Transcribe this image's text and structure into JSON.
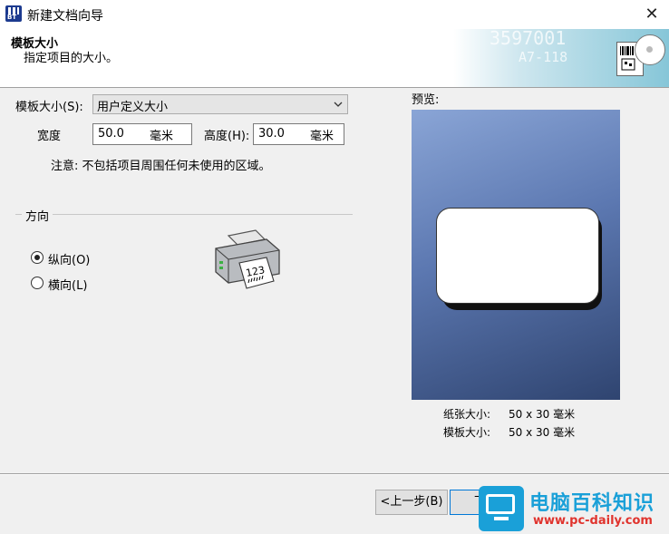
{
  "window": {
    "title": "新建文档向导",
    "close": "✕"
  },
  "header": {
    "title": "模板大小",
    "subtitle": "指定项目的大小。",
    "banner_numbers": [
      "3597001",
      "A7-118"
    ]
  },
  "form": {
    "size_label": "模板大小(S):",
    "size_value": "用户定义大小",
    "width_label": "宽度",
    "width_value": "50.0",
    "width_unit": "毫米",
    "height_label": "高度(H):",
    "height_value": "30.0",
    "height_unit": "毫米",
    "note": "注意: 不包括项目周围任何未使用的区域。"
  },
  "orientation": {
    "legend": "方向",
    "portrait": "纵向(O)",
    "landscape": "横向(L)",
    "selected": "portrait"
  },
  "preview": {
    "label": "预览:",
    "paper_size_label": "纸张大小:",
    "paper_size_value": "50 x 30 毫米",
    "template_size_label": "模板大小:",
    "template_size_value": "50 x 30 毫米"
  },
  "footer": {
    "back": "<上一步(B)",
    "next": "下一"
  },
  "watermark": {
    "title": "电脑百科知识",
    "url": "www.pc-daily.com"
  },
  "colors": {
    "accent": "#0078d7",
    "preview_top": "#8aa5d6",
    "preview_bottom": "#2f4470",
    "watermark": "#1aa0d8"
  }
}
